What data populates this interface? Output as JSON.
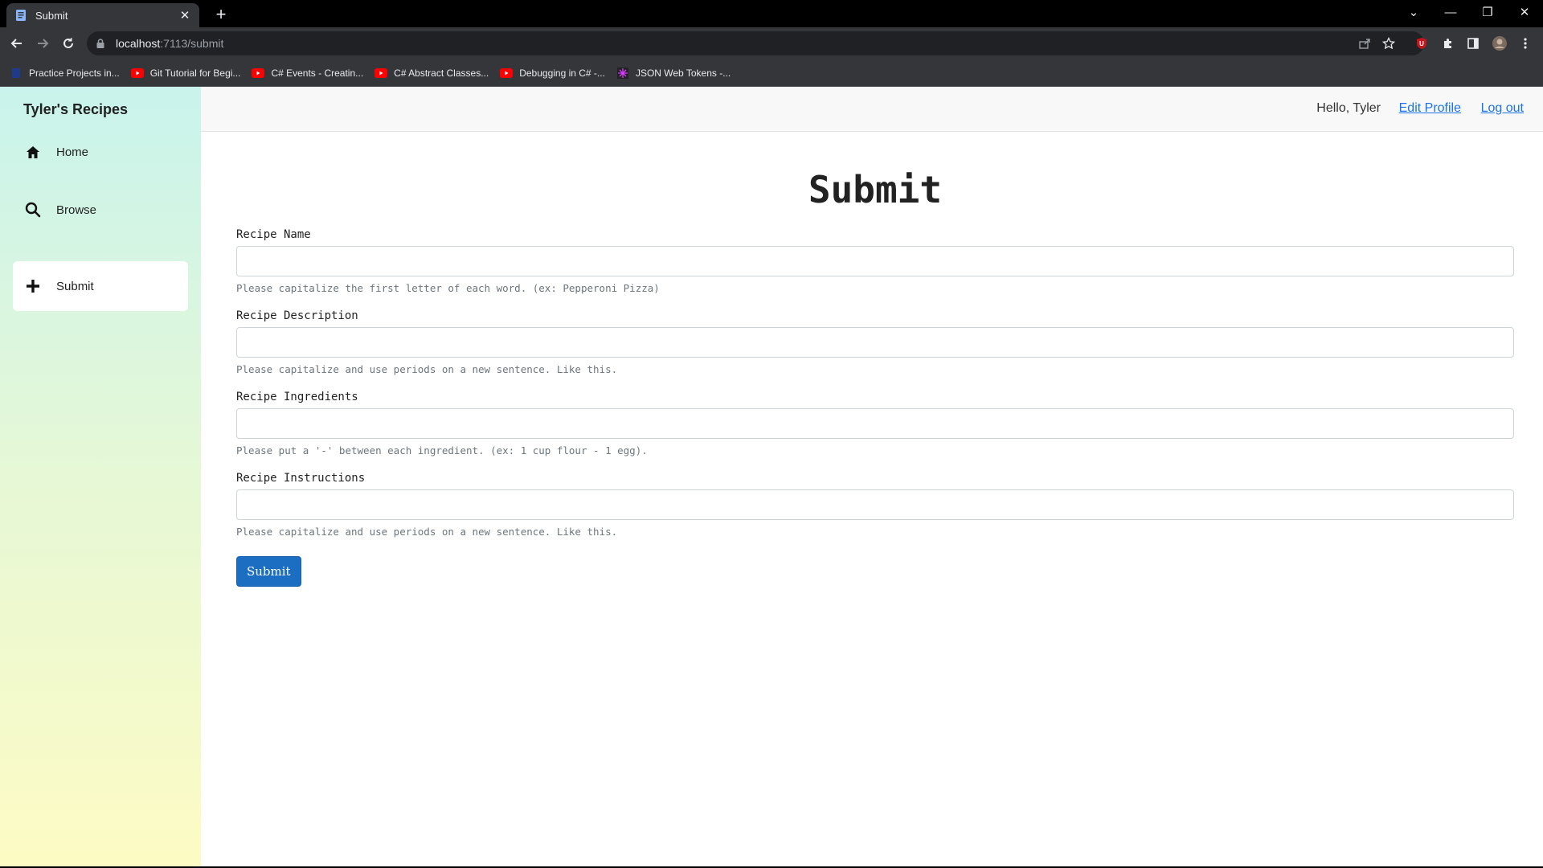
{
  "browser": {
    "tab_title": "Submit",
    "url_host": "localhost",
    "url_path": ":7113/submit",
    "bookmarks": [
      {
        "label": "Practice Projects in...",
        "icon": "page-icon"
      },
      {
        "label": "Git Tutorial for Begi...",
        "icon": "youtube-icon"
      },
      {
        "label": "C# Events - Creatin...",
        "icon": "youtube-icon"
      },
      {
        "label": "C# Abstract Classes...",
        "icon": "youtube-icon"
      },
      {
        "label": "Debugging in C# -...",
        "icon": "youtube-icon"
      },
      {
        "label": "JSON Web Tokens -...",
        "icon": "jwt-icon"
      }
    ]
  },
  "sidebar": {
    "brand": "Tyler's Recipes",
    "items": [
      {
        "label": "Home",
        "icon": "home-icon",
        "active": false
      },
      {
        "label": "Browse",
        "icon": "search-icon",
        "active": false
      },
      {
        "label": "Submit",
        "icon": "plus-icon",
        "active": true
      }
    ]
  },
  "topbar": {
    "greeting": "Hello, Tyler",
    "edit_profile": "Edit Profile",
    "logout": "Log out"
  },
  "form": {
    "title": "Submit",
    "fields": [
      {
        "label": "Recipe Name",
        "value": "",
        "help": "Please capitalize the first letter of each word. (ex: Pepperoni Pizza)"
      },
      {
        "label": "Recipe Description",
        "value": "",
        "help": "Please capitalize and use periods on a new sentence. Like this."
      },
      {
        "label": "Recipe Ingredients",
        "value": "",
        "help": "Please put a '-' between each ingredient. (ex: 1 cup flour - 1 egg)."
      },
      {
        "label": "Recipe Instructions",
        "value": "",
        "help": "Please capitalize and use periods on a new sentence. Like this."
      }
    ],
    "submit_label": "Submit"
  },
  "colors": {
    "accent": "#1b6ec2",
    "link": "#1a73e8",
    "sidebar_top": "#c9f3ec",
    "sidebar_bottom": "#fdfbc4"
  }
}
